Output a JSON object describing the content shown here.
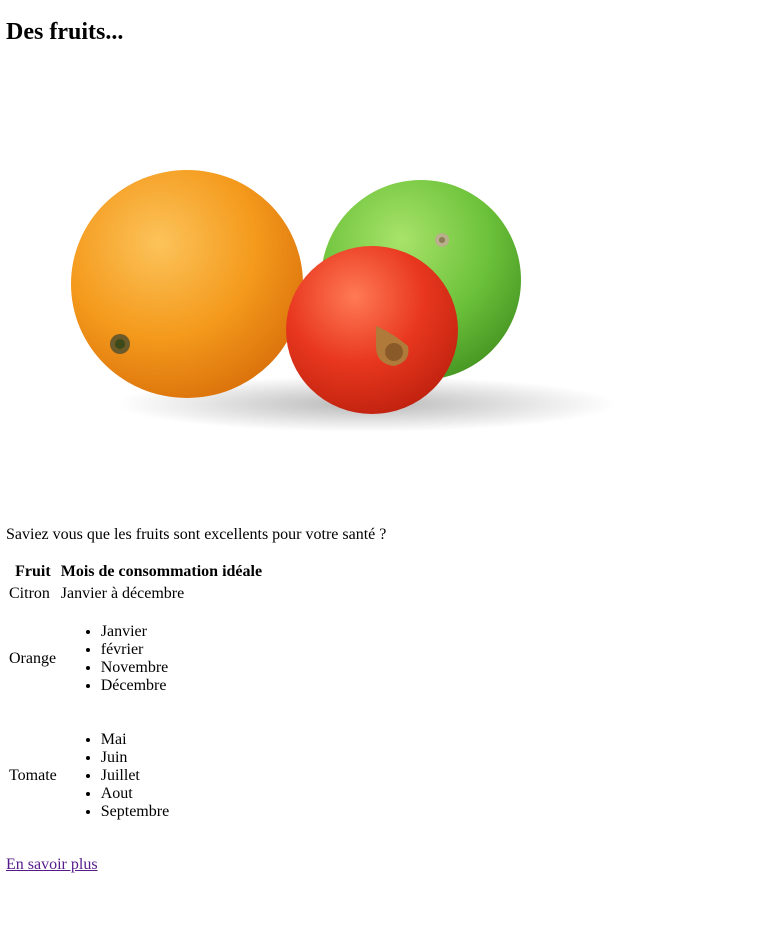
{
  "page": {
    "heading": "Des fruits...",
    "intro": "Saviez vous que les fruits sont excellents pour votre santé ?",
    "link_label": "En savoir plus"
  },
  "illustration": {
    "icon": "fruits-photo-icon",
    "items": [
      "orange",
      "citron vert",
      "tomate"
    ]
  },
  "table": {
    "headers": [
      "Fruit",
      "Mois de consommation idéale"
    ],
    "rows": [
      {
        "fruit": "Citron",
        "months_text": "Janvier à décembre"
      },
      {
        "fruit": "Orange",
        "months": [
          "Janvier",
          "février",
          "Novembre",
          "Décembre"
        ]
      },
      {
        "fruit": "Tomate",
        "months": [
          "Mai",
          "Juin",
          "Juillet",
          "Aout",
          "Septembre"
        ]
      }
    ]
  },
  "colors": {
    "link_visited": "#551a8b",
    "orange": "#f49a1c",
    "lime": "#6cc23a",
    "tomato": "#e8371e"
  }
}
